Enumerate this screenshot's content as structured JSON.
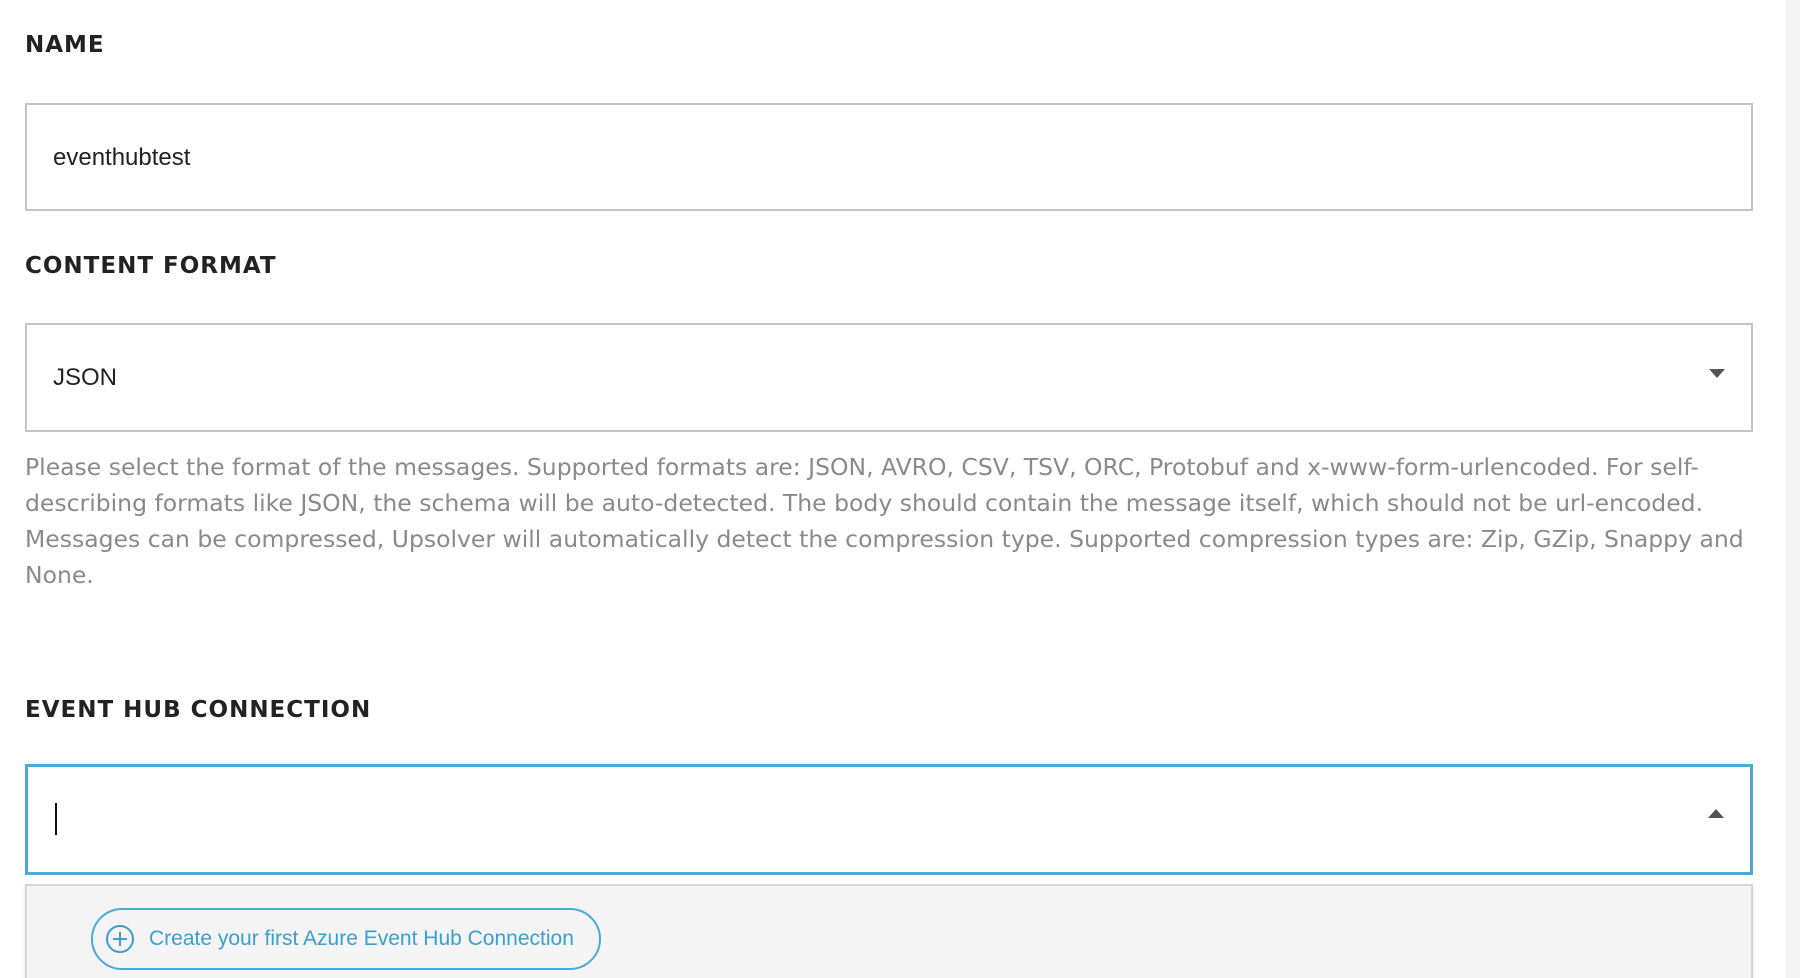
{
  "name_field": {
    "label": "NAME",
    "value": "eventhubtest"
  },
  "content_format": {
    "label": "CONTENT FORMAT",
    "selected": "JSON",
    "help_text": "Please select the format of the messages. Supported formats are: JSON, AVRO, CSV, TSV, ORC, Protobuf and x-www-form-urlencoded. For self-describing formats like JSON, the schema will be auto-detected. The body should contain the message itself, which should not be url-encoded. Messages can be compressed, Upsolver will automatically detect the compression type. Supported compression types are: Zip, GZip, Snappy and None."
  },
  "event_hub_connection": {
    "label": "EVENT HUB CONNECTION",
    "value": "",
    "dropdown": {
      "create_label": "Create your first Azure Event Hub Connection"
    }
  },
  "colors": {
    "accent": "#4aaad8",
    "label_text": "#222222",
    "help_text": "#8a8a8a",
    "border": "#c4c4c4",
    "dropdown_bg": "#f4f4f4"
  },
  "icons": {
    "content_format_toggle": "chevron-down-icon",
    "connection_toggle": "chevron-up-icon",
    "create_icon": "plus-circle-icon"
  }
}
